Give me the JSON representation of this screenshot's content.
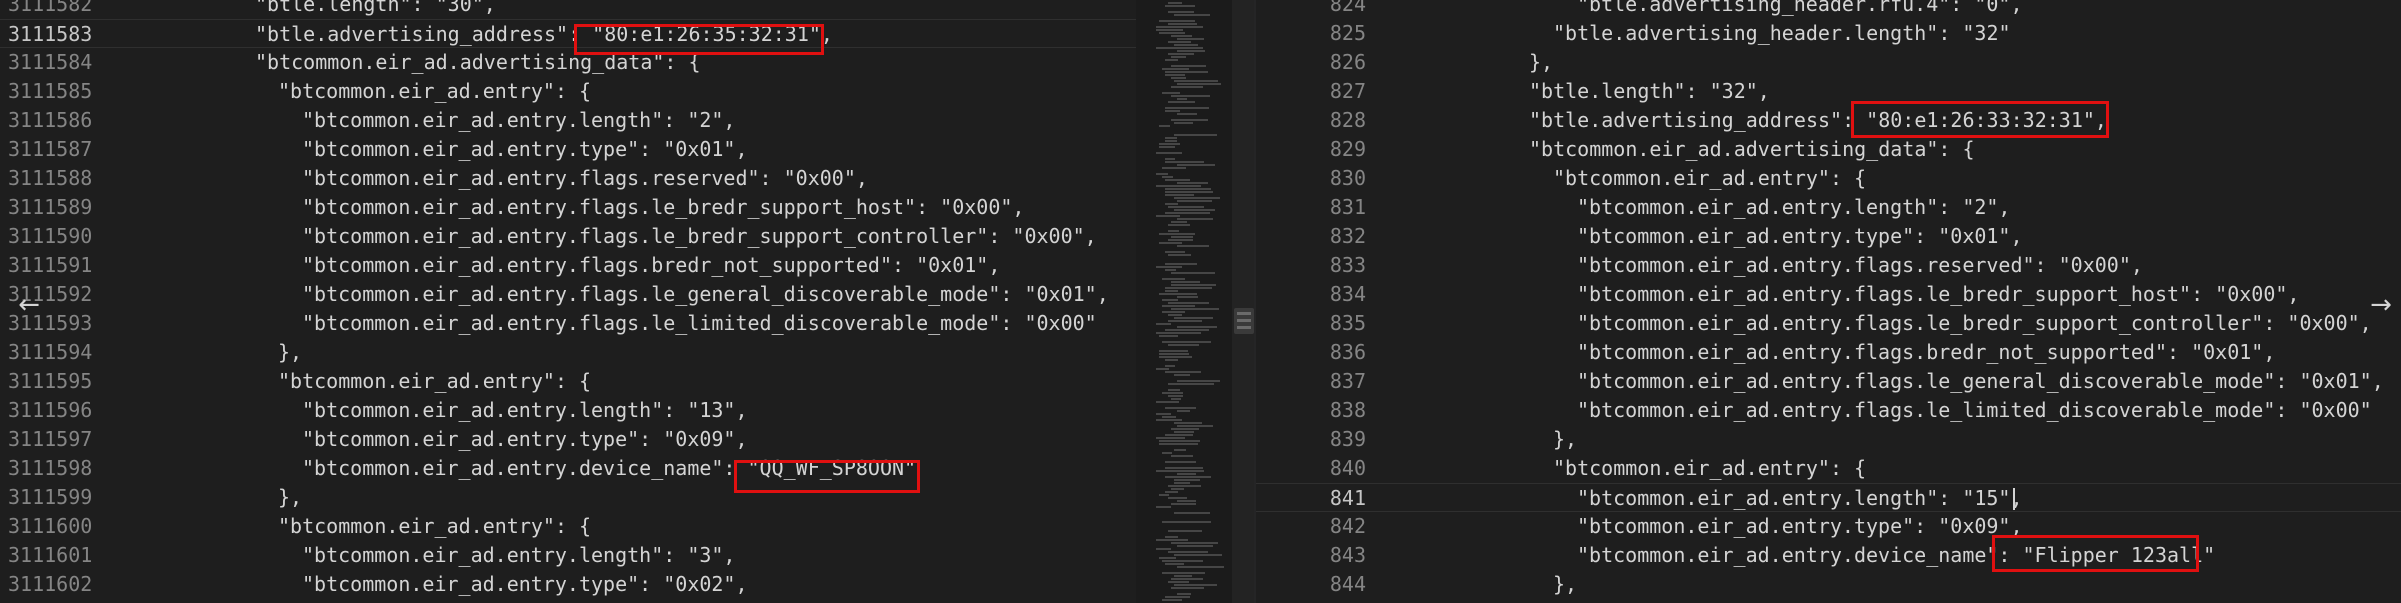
{
  "left": {
    "lines": [
      {
        "n": "3111582",
        "indent": 17,
        "code": "\"btle.length\": \"30\","
      },
      {
        "n": "3111583",
        "indent": 17,
        "code": "\"btle.advertising_address\": \"80:e1:26:35:32:31\",",
        "active": true
      },
      {
        "n": "3111584",
        "indent": 17,
        "code": "\"btcommon.eir_ad.advertising_data\": {"
      },
      {
        "n": "3111585",
        "indent": 19,
        "code": "\"btcommon.eir_ad.entry\": {"
      },
      {
        "n": "3111586",
        "indent": 21,
        "code": "\"btcommon.eir_ad.entry.length\": \"2\","
      },
      {
        "n": "3111587",
        "indent": 21,
        "code": "\"btcommon.eir_ad.entry.type\": \"0x01\","
      },
      {
        "n": "3111588",
        "indent": 21,
        "code": "\"btcommon.eir_ad.entry.flags.reserved\": \"0x00\","
      },
      {
        "n": "3111589",
        "indent": 21,
        "code": "\"btcommon.eir_ad.entry.flags.le_bredr_support_host\": \"0x00\","
      },
      {
        "n": "3111590",
        "indent": 21,
        "code": "\"btcommon.eir_ad.entry.flags.le_bredr_support_controller\": \"0x00\","
      },
      {
        "n": "3111591",
        "indent": 21,
        "code": "\"btcommon.eir_ad.entry.flags.bredr_not_supported\": \"0x01\","
      },
      {
        "n": "3111592",
        "indent": 21,
        "code": "\"btcommon.eir_ad.entry.flags.le_general_discoverable_mode\": \"0x01\","
      },
      {
        "n": "3111593",
        "indent": 21,
        "code": "\"btcommon.eir_ad.entry.flags.le_limited_discoverable_mode\": \"0x00\""
      },
      {
        "n": "3111594",
        "indent": 19,
        "code": "},"
      },
      {
        "n": "3111595",
        "indent": 19,
        "code": "\"btcommon.eir_ad.entry\": {"
      },
      {
        "n": "3111596",
        "indent": 21,
        "code": "\"btcommon.eir_ad.entry.length\": \"13\","
      },
      {
        "n": "3111597",
        "indent": 21,
        "code": "\"btcommon.eir_ad.entry.type\": \"0x09\","
      },
      {
        "n": "3111598",
        "indent": 21,
        "code": "\"btcommon.eir_ad.entry.device_name\": \"QQ_WF_SP8OON\""
      },
      {
        "n": "3111599",
        "indent": 19,
        "code": "},"
      },
      {
        "n": "3111600",
        "indent": 19,
        "code": "\"btcommon.eir_ad.entry\": {"
      },
      {
        "n": "3111601",
        "indent": 21,
        "code": "\"btcommon.eir_ad.entry.length\": \"3\","
      },
      {
        "n": "3111602",
        "indent": 21,
        "code": "\"btcommon.eir_ad.entry.type\": \"0x02\","
      }
    ]
  },
  "right": {
    "lines": [
      {
        "n": "824",
        "indent": 15,
        "code": "\"btle.advertising_header.rfu.4\": \"0\","
      },
      {
        "n": "825",
        "indent": 13,
        "code": "\"btle.advertising_header.length\": \"32\""
      },
      {
        "n": "826",
        "indent": 11,
        "code": "},"
      },
      {
        "n": "827",
        "indent": 11,
        "code": "\"btle.length\": \"32\","
      },
      {
        "n": "828",
        "indent": 11,
        "code": "\"btle.advertising_address\": \"80:e1:26:33:32:31\","
      },
      {
        "n": "829",
        "indent": 11,
        "code": "\"btcommon.eir_ad.advertising_data\": {"
      },
      {
        "n": "830",
        "indent": 13,
        "code": "\"btcommon.eir_ad.entry\": {"
      },
      {
        "n": "831",
        "indent": 15,
        "code": "\"btcommon.eir_ad.entry.length\": \"2\","
      },
      {
        "n": "832",
        "indent": 15,
        "code": "\"btcommon.eir_ad.entry.type\": \"0x01\","
      },
      {
        "n": "833",
        "indent": 15,
        "code": "\"btcommon.eir_ad.entry.flags.reserved\": \"0x00\","
      },
      {
        "n": "834",
        "indent": 15,
        "code": "\"btcommon.eir_ad.entry.flags.le_bredr_support_host\": \"0x00\","
      },
      {
        "n": "835",
        "indent": 15,
        "code": "\"btcommon.eir_ad.entry.flags.le_bredr_support_controller\": \"0x00\","
      },
      {
        "n": "836",
        "indent": 15,
        "code": "\"btcommon.eir_ad.entry.flags.bredr_not_supported\": \"0x01\","
      },
      {
        "n": "837",
        "indent": 15,
        "code": "\"btcommon.eir_ad.entry.flags.le_general_discoverable_mode\": \"0x01\","
      },
      {
        "n": "838",
        "indent": 15,
        "code": "\"btcommon.eir_ad.entry.flags.le_limited_discoverable_mode\": \"0x00\""
      },
      {
        "n": "839",
        "indent": 13,
        "code": "},"
      },
      {
        "n": "840",
        "indent": 13,
        "code": "\"btcommon.eir_ad.entry\": {"
      },
      {
        "n": "841",
        "indent": 15,
        "code": "\"btcommon.eir_ad.entry.length\": \"15\",",
        "active": true
      },
      {
        "n": "842",
        "indent": 15,
        "code": "\"btcommon.eir_ad.entry.type\": \"0x09\","
      },
      {
        "n": "843",
        "indent": 15,
        "code": "\"btcommon.eir_ad.entry.device_name\": \"Flipper 123all\""
      },
      {
        "n": "844",
        "indent": 13,
        "code": "},"
      }
    ]
  },
  "navigation": {
    "prev_icon": "←",
    "next_icon": "→"
  },
  "colors": {
    "highlight_box": "#e01010",
    "background": "#1e1e1e"
  }
}
